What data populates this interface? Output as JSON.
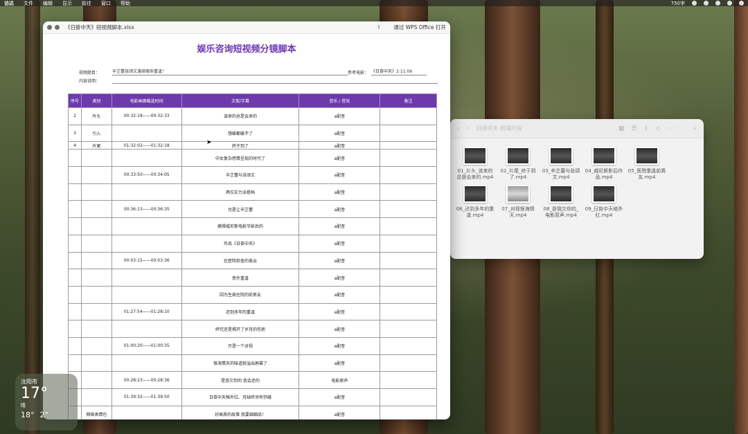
{
  "menubar": {
    "items": [
      "访达",
      "文件",
      "编辑",
      "显示",
      "前往",
      "窗口",
      "帮助"
    ],
    "status": "750字"
  },
  "sheet_window": {
    "title": "《日掛中天》短视频脚本.xlsx",
    "open_with": "通过 WPS Office 打开",
    "doc_title": "娱乐咨询短视频分镜脚本",
    "video_title_label": "视频题目：",
    "video_title_value": "辛芷蕾张颂文演绎宿命重逢！",
    "ref_label": "参考电影：",
    "ref_value": "《日掛中天》2:11:06",
    "desc_label": "内容说明：",
    "headers": [
      "序号",
      "类别",
      "电影画面截选时间",
      "文案/字幕",
      "音乐 / 音效",
      "备注"
    ],
    "rows": [
      [
        "2",
        "片头",
        "00:32:18——00:32:33",
        "该来的总是会来的",
        "a配音",
        ""
      ],
      [
        "3",
        "引入",
        "",
        "想躲都躲不了",
        "a配音",
        ""
      ],
      [
        "4",
        "片尾",
        "01:32:02——01:32:18",
        "终于到了",
        "a配音",
        ""
      ],
      [
        "",
        "",
        "",
        "中女复杂感情呈现的时代了",
        "a配音",
        ""
      ],
      [
        "",
        "",
        "00:33:50——00:34:05",
        "辛芷蕾与张颂文",
        "a配音",
        ""
      ],
      [
        "",
        "",
        "",
        "两位实力派搭档",
        "a配音",
        ""
      ],
      [
        "",
        "",
        "00:36:13——00:36:35",
        "也是让辛芷蕾",
        "a配音",
        ""
      ],
      [
        "",
        "",
        "",
        "摘得威尼斯电影节影后的",
        "a配音",
        ""
      ],
      [
        "",
        "",
        "",
        "作品《日掛中天》",
        "a配音",
        ""
      ],
      [
        "",
        "",
        "00:03:15——00:03:36",
        "在医院检查的美云",
        "a配音",
        ""
      ],
      [
        "",
        "",
        "",
        "意外重逢",
        "a配音",
        ""
      ],
      [
        "",
        "",
        "",
        "因为生病住院的前男友",
        "a配音",
        ""
      ],
      [
        "",
        "",
        "01:27:54——01:28:10",
        "迟到多年的重逢",
        "a配音",
        ""
      ],
      [
        "",
        "",
        "",
        "终究还是揭开了岁月的伤疤",
        "a配音",
        ""
      ],
      [
        "",
        "",
        "01:00:20——01:00:35",
        "只是一个对视",
        "a配音",
        ""
      ],
      [
        "",
        "",
        "",
        "恨海情天的味道就溢出屏幕了",
        "a配音",
        ""
      ],
      [
        "",
        "",
        "00:28:23——00:28:36",
        "是我欠你的 我会还的",
        "电影原声",
        ""
      ],
      [
        "",
        "",
        "01:39:32——01:39:50",
        "日掛中天格外红、月缺终须有弥缝",
        "a配音",
        ""
      ],
      [
        "",
        "网络表情包",
        "",
        "好高质的故事 我要细细品！",
        "a配音",
        ""
      ]
    ]
  },
  "finder": {
    "title": "日掛中天-剪辑片段",
    "files": [
      {
        "name": "01_片头_该来的总是会来的.mp4",
        "thumb": "dark"
      },
      {
        "name": "02_片尾_终于到了.mp4",
        "thumb": "dark"
      },
      {
        "name": "03_辛芷蕾与张颂文.mp4",
        "thumb": "dark"
      },
      {
        "name": "04_威尼斯影后作品.mp4",
        "thumb": "dark"
      },
      {
        "name": "05_医院重逢前男友.mp4",
        "thumb": "dark"
      },
      {
        "name": "06_迟到多年的重逢.mp4",
        "thumb": "dark"
      },
      {
        "name": "07_对视恨海情天.mp4",
        "thumb": "light"
      },
      {
        "name": "08_是我欠你的_电影原声.mp4",
        "thumb": "dark"
      },
      {
        "name": "09_日掛中天格外红.mp4",
        "thumb": "dark"
      }
    ]
  },
  "weather": {
    "city": "沈阳市",
    "temp": "17°",
    "condition": "晴",
    "high": "18°",
    "low": "2°"
  }
}
